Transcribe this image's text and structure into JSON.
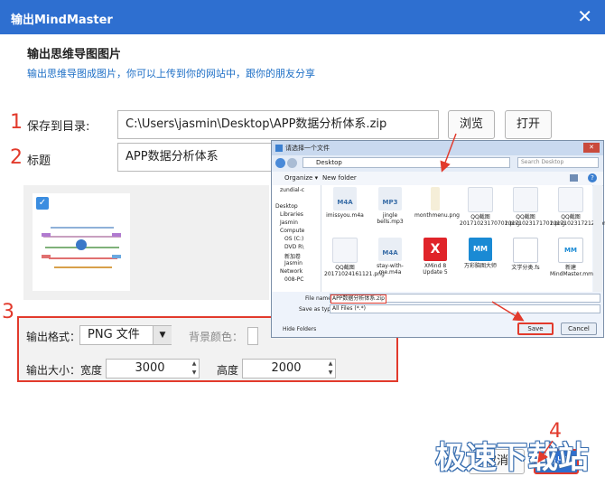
{
  "window": {
    "title": "输出MindMaster",
    "close_glyph": "✕"
  },
  "header": {
    "heading": "输出思维导图图片",
    "subtitle": "输出思维导图成图片，你可以上传到你的网站中，跟你的朋友分享"
  },
  "markers": {
    "m1": "1",
    "m2": "2",
    "m3": "3",
    "m4": "4"
  },
  "save": {
    "label": "保存到目录:",
    "path": "C:\\Users\\jasmin\\Desktop\\APP数据分析体系.zip",
    "browse": "浏览",
    "open": "打开"
  },
  "title_row": {
    "label": "标题",
    "value": "APP数据分析体系"
  },
  "format": {
    "label": "输出格式：",
    "selected": "PNG 文件",
    "bg_label": "背景颜色："
  },
  "size": {
    "label": "输出大小：",
    "width_label": "宽度",
    "width": "3000",
    "height_label": "高度",
    "height": "2000"
  },
  "footer": {
    "cancel": "取消",
    "export": "输出"
  },
  "watermark": "极速下载站",
  "file_dialog": {
    "title": "请选择一个文件",
    "address": "Desktop",
    "search_placeholder": "Search Desktop",
    "organize": "Organize ▾",
    "new_folder": "New folder",
    "tree": [
      "zundial-c",
      "Desktop",
      "Libraries",
      "Jasmin",
      "Compute",
      "OS (C:)",
      "DVD R\\",
      "新加卷",
      "Jasmin",
      "Network",
      "008-PC",
      "",
      ""
    ],
    "files_row1": [
      "imissyou.m4a",
      "jingle bells.mp3",
      "monthmenu.png",
      "QQ截图20171023170701.png",
      "QQ截图20171023171701.png",
      "QQ截图20171023172127.png"
    ],
    "files_row2": [
      "QQ截图20171024161121.png",
      "stay-with-me.m4a",
      "XMind 8 Update 5",
      "万彩脑图大师",
      "文学分类.fs",
      "新建MindMaster.mm"
    ],
    "filename_label": "File name:",
    "filename": "APP数据分析体系.zip",
    "type_label": "Save as type:",
    "type_value": "All Files (*.*)",
    "hide_folders": "Hide Folders",
    "save": "Save",
    "cancel": "Cancel",
    "icon_tags": {
      "m4a": "M4A",
      "mp3": "MP3",
      "mm": "MM"
    }
  },
  "colors": {
    "titlebar": "#2e6fd0",
    "accent_red": "#e23a2c",
    "link_blue": "#1e6fc6"
  }
}
